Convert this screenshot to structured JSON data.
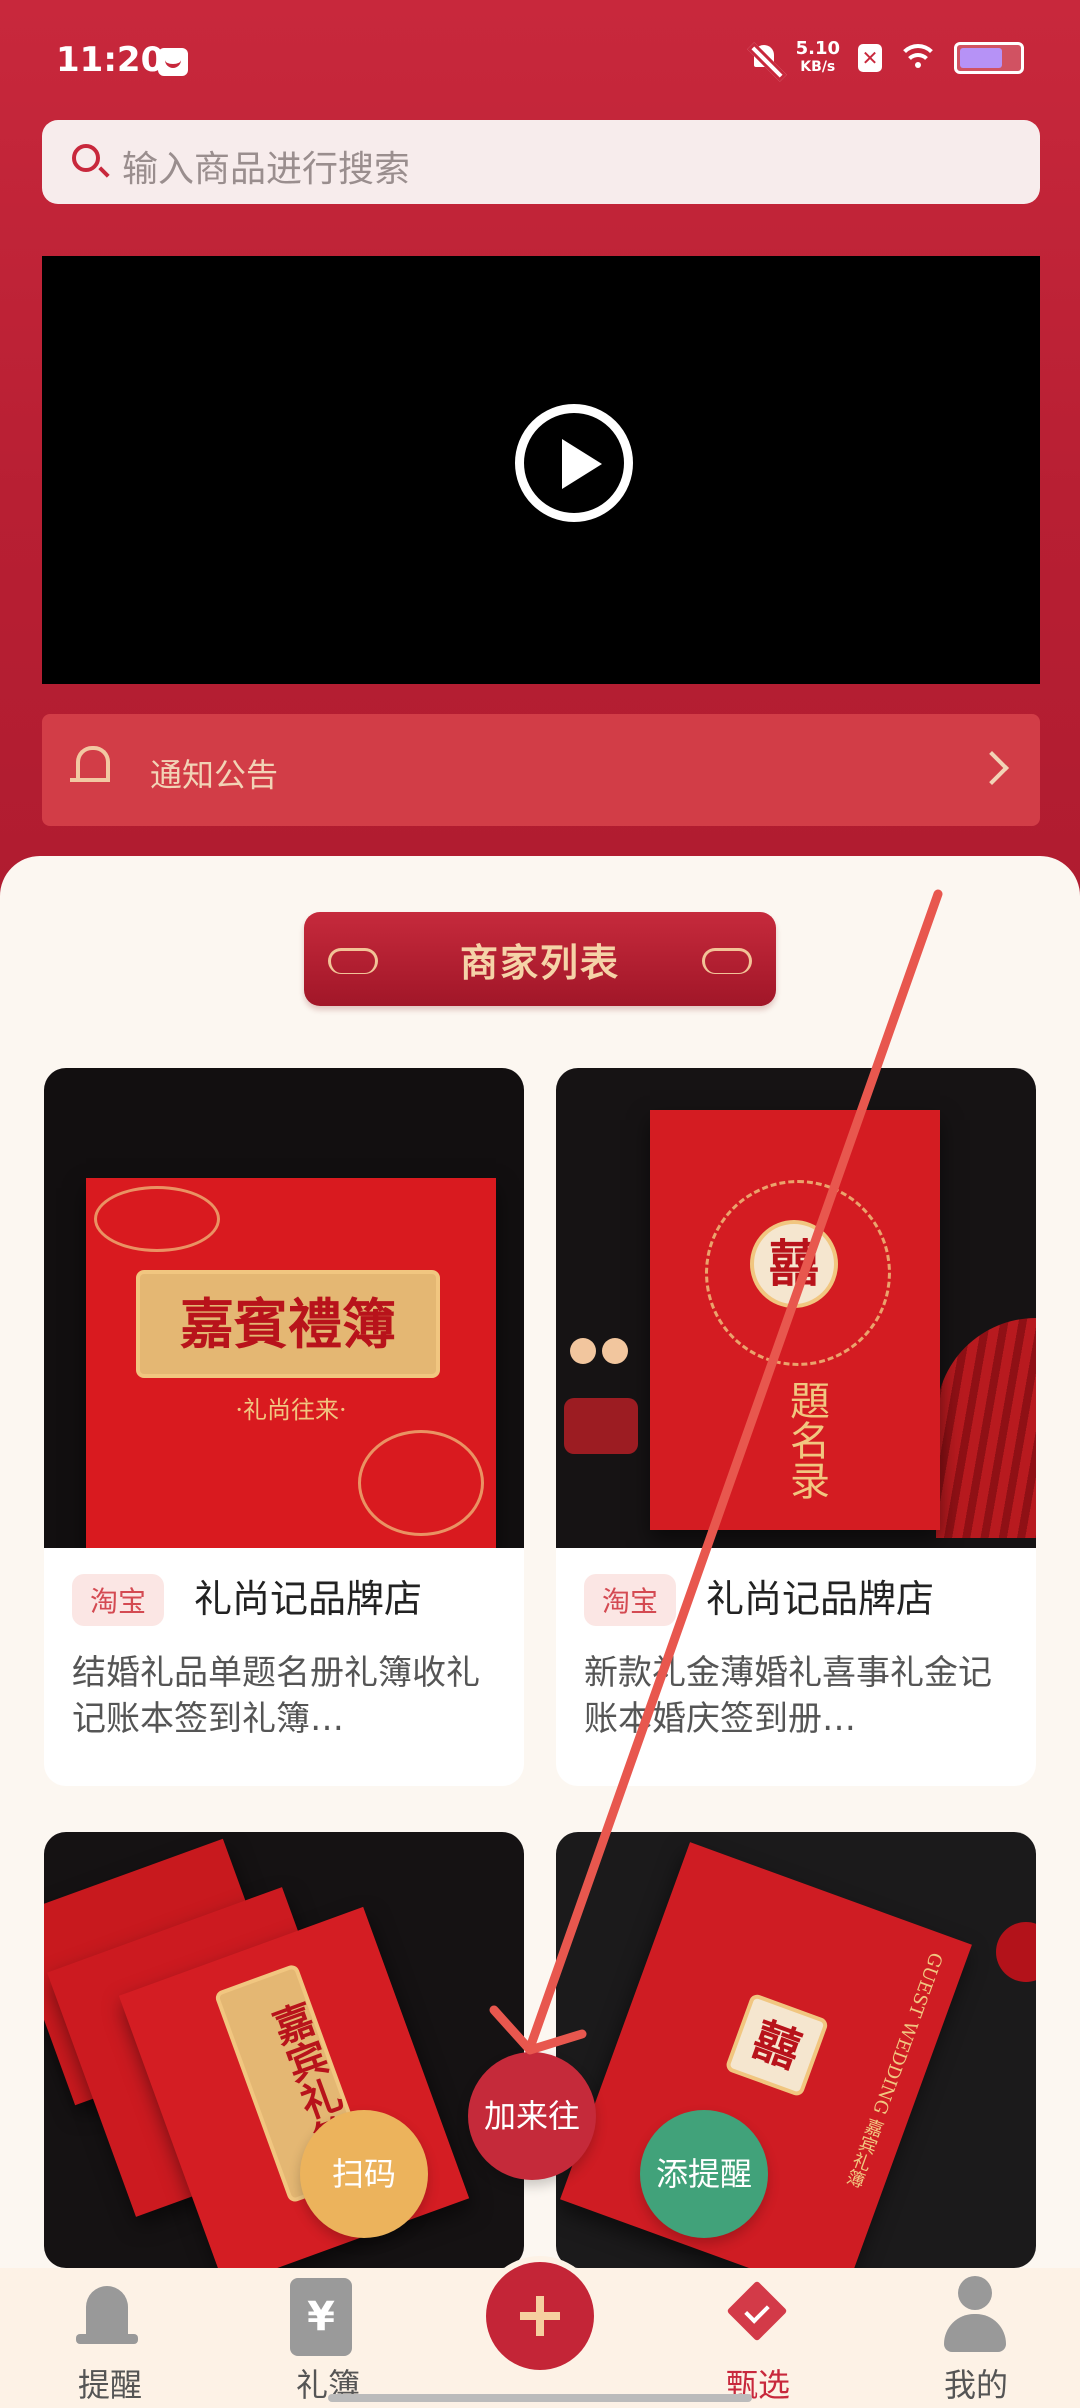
{
  "status_bar": {
    "time": "11:20",
    "net_speed_value": "5.10",
    "net_speed_unit": "KB/s",
    "icons": [
      "message-icon",
      "bell-off-icon",
      "x-badge-icon",
      "wifi-icon",
      "battery-icon"
    ]
  },
  "search": {
    "placeholder": "输入商品进行搜索"
  },
  "video": {
    "icon": "play-icon"
  },
  "notice": {
    "label": "通知公告"
  },
  "merchant_list": {
    "title": "商家列表"
  },
  "products": [
    {
      "platform": "淘宝",
      "shop": "礼尚记品牌店",
      "desc": "结婚礼品单题名册礼簿收礼记账本签到礼簿…",
      "cover_text": "嘉賓禮簿",
      "cover_subtext": "·礼尚往来·"
    },
    {
      "platform": "淘宝",
      "shop": "礼尚记品牌店",
      "desc": "新款礼金薄婚礼喜事礼金记账本婚庆签到册…",
      "cover_text": "囍",
      "cover_subtext": "題名录"
    },
    {
      "cover_text": "嘉宾礼簿"
    },
    {
      "cover_text": "囍",
      "cover_subtext": "GUEST WEDDING 嘉宾礼簿"
    }
  ],
  "fabs": {
    "scan": "扫码",
    "add": "加来往",
    "remind": "添提醒"
  },
  "bottom_nav": {
    "items": [
      {
        "label": "提醒",
        "icon": "bell-icon"
      },
      {
        "label": "礼簿",
        "icon": "ledger-icon",
        "glyph": "¥"
      },
      {
        "label": "",
        "icon": "plus-icon"
      },
      {
        "label": "甄选",
        "icon": "select-icon",
        "active": true
      },
      {
        "label": "我的",
        "icon": "profile-icon"
      }
    ]
  },
  "colors": {
    "brand_red": "#c8283c",
    "gold": "#f2c8a2",
    "scan": "#ecb35c",
    "remind": "#41a27a"
  }
}
